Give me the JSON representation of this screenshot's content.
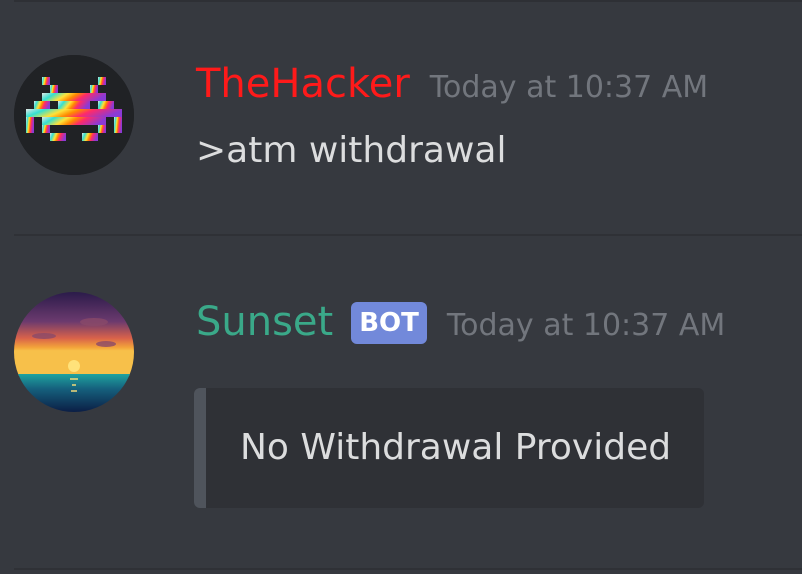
{
  "messages": [
    {
      "author": "TheHacker",
      "author_color": "#ff1a1a",
      "timestamp": "Today at 10:37 AM",
      "content": ">atm withdrawal",
      "avatar_icon": "space-invader-icon"
    },
    {
      "author": "Sunset",
      "author_color": "#3aa989",
      "bot_tag": "BOT",
      "timestamp": "Today at 10:37 AM",
      "avatar_icon": "sunset-icon",
      "embed": {
        "description": "No Withdrawal Provided",
        "bar_color": "#4f545c"
      }
    }
  ],
  "colors": {
    "background": "#36393f",
    "embed_background": "#2f3136",
    "text": "#dcddde",
    "muted": "#72767d",
    "bot_tag": "#7289da"
  }
}
